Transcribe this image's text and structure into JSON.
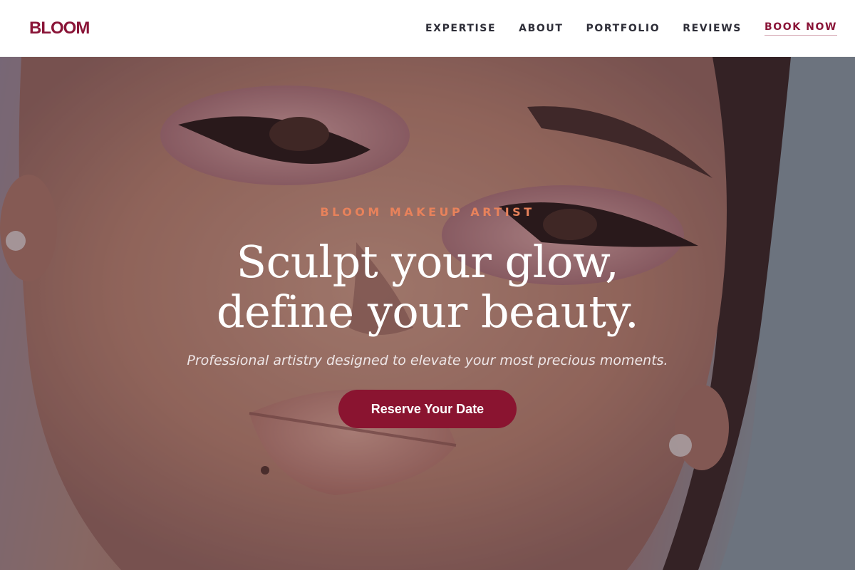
{
  "brand": {
    "name": "BLOOM"
  },
  "nav": {
    "items": [
      {
        "label": "EXPERTISE"
      },
      {
        "label": "ABOUT"
      },
      {
        "label": "PORTFOLIO"
      },
      {
        "label": "REVIEWS"
      },
      {
        "label": "BOOK NOW"
      }
    ]
  },
  "hero": {
    "eyebrow": "BLOOM MAKEUP ARTIST",
    "headline_line1": "Sculpt your glow,",
    "headline_line2": "define your beauty.",
    "subtitle": "Professional artistry designed to elevate your most precious moments.",
    "cta_label": "Reserve Your Date"
  },
  "colors": {
    "brand": "#8a1538",
    "accent": "#e8825b",
    "nav_text": "#2e2e38",
    "cta_bg": "#8a1430"
  }
}
